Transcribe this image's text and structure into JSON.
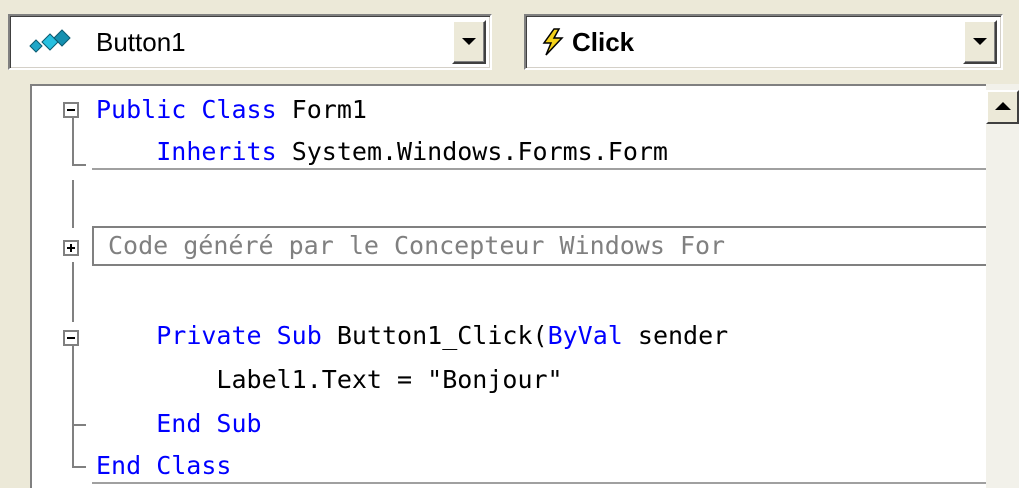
{
  "object_combo": {
    "value": "Button1",
    "icon": "class-members-icon"
  },
  "event_combo": {
    "value": "Click",
    "icon": "lightning-event-icon"
  },
  "editor": {
    "lines": [
      {
        "kw1": "Public Class",
        "rest": " Form1"
      },
      {
        "indent": "    ",
        "kw1": "Inherits",
        "rest": " System.Windows.Forms.Form"
      },
      {
        "collapsed": "Code généré par le Concepteur Windows For"
      },
      {
        "indent": "    ",
        "kw1": "Private Sub",
        "rest": " Button1_Click(",
        "kw2": "ByVal",
        "rest2": " sender"
      },
      {
        "indent": "        ",
        "rest": "Label1.Text = \"Bonjour\""
      },
      {
        "indent": "    ",
        "kw1": "End Sub"
      },
      {
        "kw1": "End Class"
      }
    ]
  },
  "colors": {
    "keyword": "#0000ff",
    "text": "#000000",
    "collapsed_text": "#808080",
    "chrome": "#ece9d8"
  }
}
